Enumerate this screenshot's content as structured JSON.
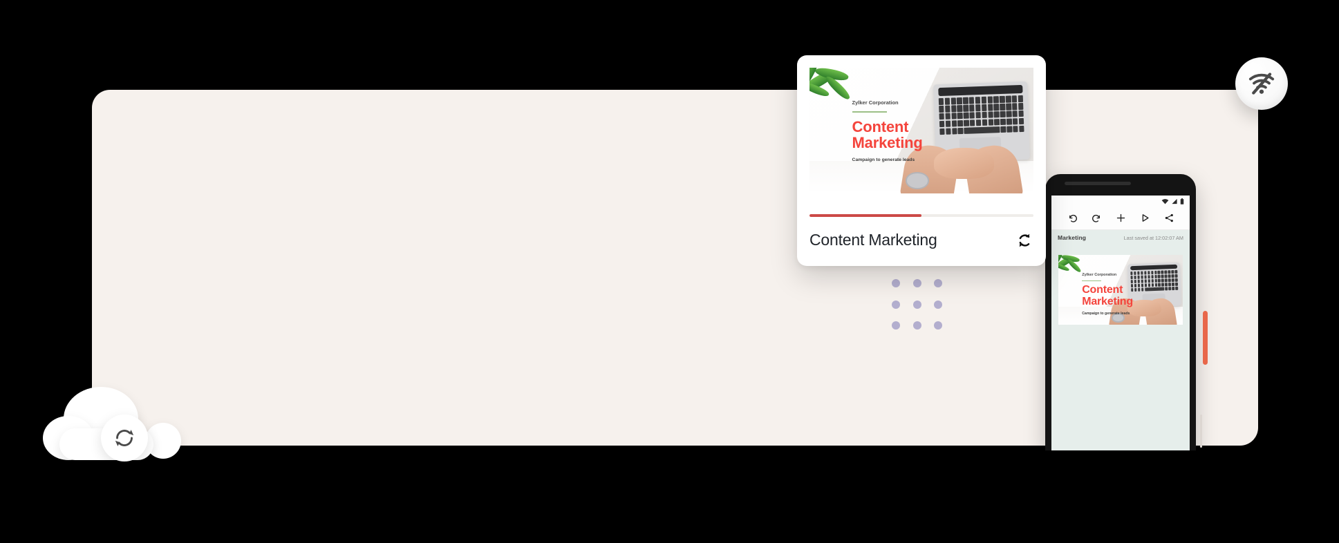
{
  "panel": {
    "background_color": "#F6F1ED"
  },
  "card": {
    "title": "Content Marketing",
    "sync_icon": "sync-icon",
    "progress_percent": 50,
    "progress_color": "#CC4A47",
    "slide": {
      "company": "Zylker Corporation",
      "title_line1": "Content",
      "title_line2": "Marketing",
      "subtitle": "Campaign to generate leads",
      "title_color": "#F4443C",
      "rule_color": "#9CBF86"
    }
  },
  "tablet": {
    "status_bar": {
      "wifi_icon": "wifi-icon",
      "signal_icon": "signal-icon",
      "battery_icon": "battery-icon"
    },
    "toolbar": [
      {
        "name": "undo-icon",
        "label": "Undo"
      },
      {
        "name": "redo-icon",
        "label": "Redo"
      },
      {
        "name": "add-icon",
        "label": "Add"
      },
      {
        "name": "present-icon",
        "label": "Present"
      },
      {
        "name": "share-icon",
        "label": "Share"
      }
    ],
    "doc_name": "Marketing",
    "last_saved": "Last saved at 12:02:07 AM",
    "screen_background": "#E6EEEB",
    "slide": {
      "company": "Zylker Corporation",
      "title_line1": "Content",
      "title_line2": "Marketing",
      "subtitle": "Campaign to generate leads",
      "title_color": "#F4443C",
      "rule_color": "#9CBF86"
    }
  },
  "wifi_badge": {
    "icon": "wifi-off-icon"
  },
  "cloud": {
    "icon": "cloud-sync-icon"
  },
  "decor": {
    "dot_color": "#B3AECE",
    "dot_count": 9,
    "accent_bar_color": "#E8674A"
  }
}
